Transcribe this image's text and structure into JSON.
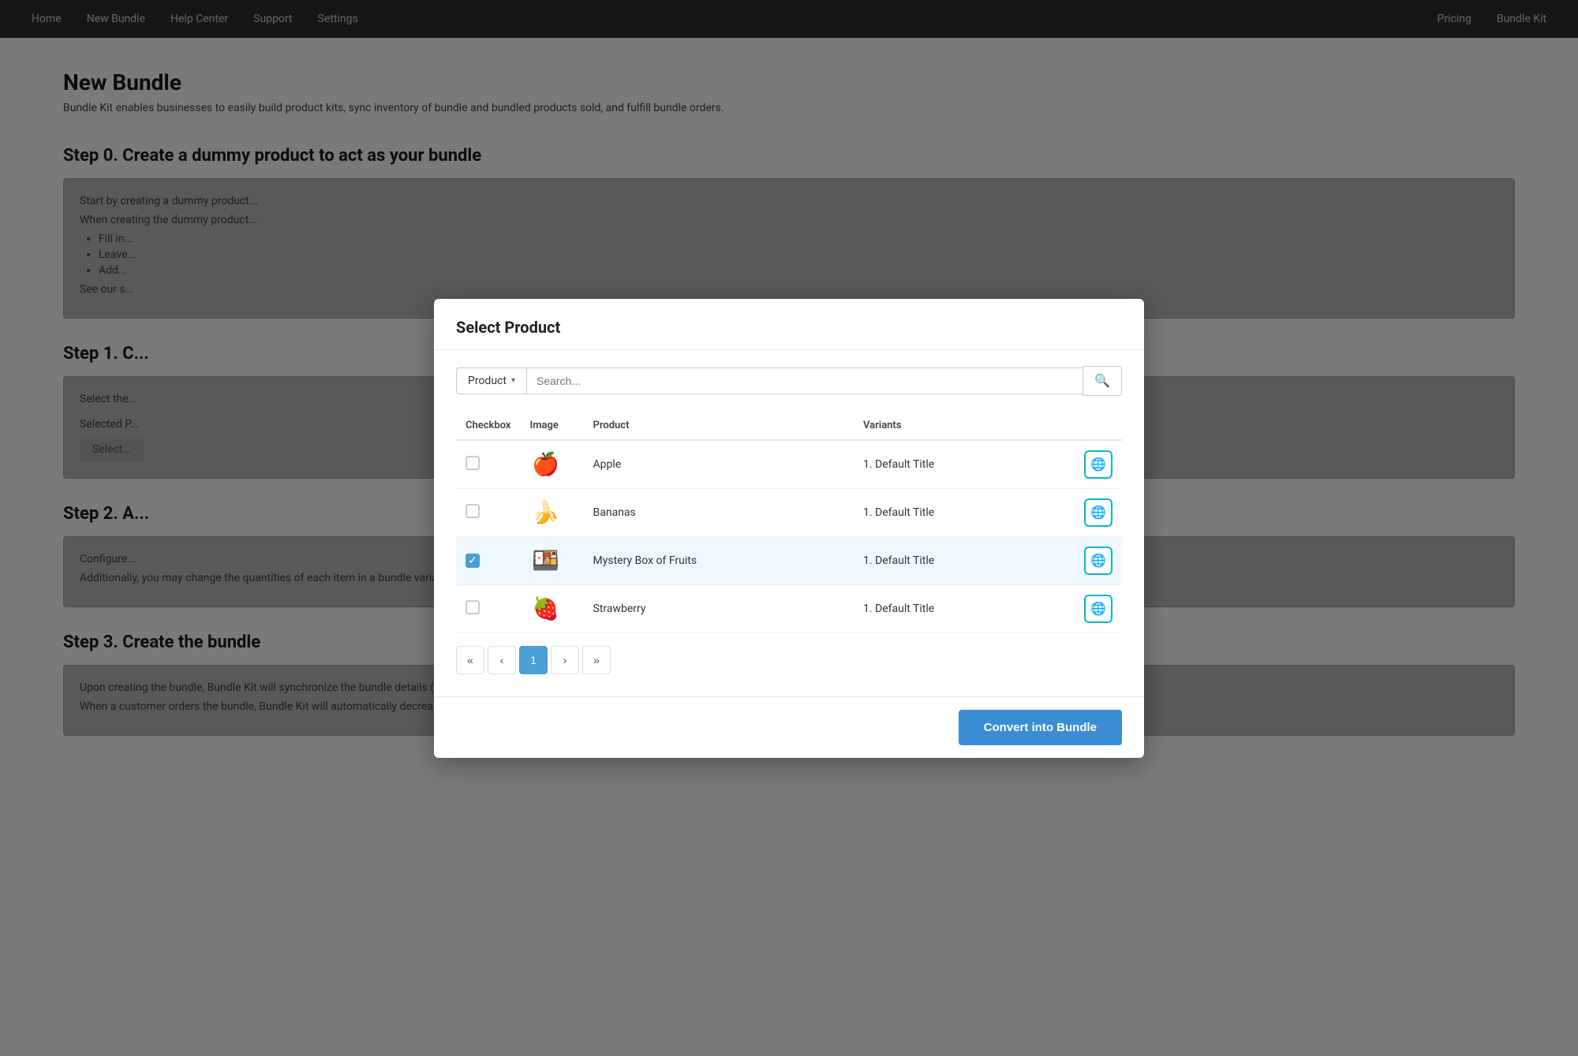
{
  "nav": {
    "left_items": [
      "Home",
      "New Bundle",
      "Help Center",
      "Support",
      "Settings"
    ],
    "right_items": [
      "Pricing",
      "Bundle Kit"
    ]
  },
  "page": {
    "title": "New Bundle",
    "subtitle": "Bundle Kit enables businesses to easily build product kits, sync inventory of bundle and bundled products sold, and fulfill bundle orders.",
    "step0_heading": "Step 0. Create a dummy product to act as your bundle",
    "step0_text": "Start by creating a dummy product...",
    "step0_when": "When creating the dummy product...",
    "step0_bullets": [
      "Fill in...",
      "Leave...",
      "Add..."
    ],
    "step0_see": "See our s...",
    "step1_heading": "Step 1. C...",
    "step1_select_text": "Select the...",
    "step1_selected_text": "Selected P...",
    "step1_button": "Select...",
    "step2_heading": "Step 2. A...",
    "step2_configure": "Configure...",
    "step2_additionally": "Additionally, you may change the quantities of each item in a bundle variant and also override the price of each bundle variant.",
    "step3_heading": "Step 3. Create the bundle",
    "step3_text1": "Upon creating the bundle, Bundle Kit will synchronize the bundle details (total price, total weight, total inventory etc.) with the dummy bundle product in Shopify.",
    "step3_text2": "When a customer orders the bundle, Bundle Kit will automatically decrease the inventory levels of both the bundle and the bundle items sold in real time."
  },
  "modal": {
    "title": "Select Product",
    "filter_label": "Product",
    "search_placeholder": "Search...",
    "table_headers": {
      "checkbox": "Checkbox",
      "image": "Image",
      "product": "Product",
      "variants": "Variants"
    },
    "products": [
      {
        "id": 1,
        "emoji": "🍎",
        "name": "Apple",
        "variants": "1.  Default Title",
        "checked": false
      },
      {
        "id": 2,
        "emoji": "🍌",
        "name": "Bananas",
        "variants": "1.  Default Title",
        "checked": false
      },
      {
        "id": 3,
        "emoji": "🍱",
        "name": "Mystery Box of Fruits",
        "variants": "1.  Default Title",
        "checked": true
      },
      {
        "id": 4,
        "emoji": "🍓",
        "name": "Strawberry",
        "variants": "1.  Default Title",
        "checked": false
      }
    ],
    "pagination": {
      "first": "«",
      "prev": "‹",
      "current": "1",
      "next": "›",
      "last": "»"
    },
    "convert_button": "Convert into Bundle"
  }
}
